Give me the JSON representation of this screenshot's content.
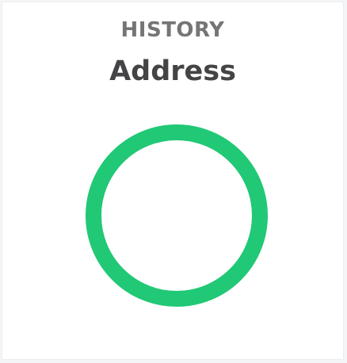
{
  "card": {
    "eyebrow": "HISTORY",
    "title": "Address"
  },
  "indicator": {
    "icon": "status-ring-icon",
    "color": "#21c875"
  },
  "colors": {
    "eyebrow": "#757575",
    "title": "#444446",
    "card_background": "#ffffff",
    "page_background": "#f4f5f6"
  }
}
